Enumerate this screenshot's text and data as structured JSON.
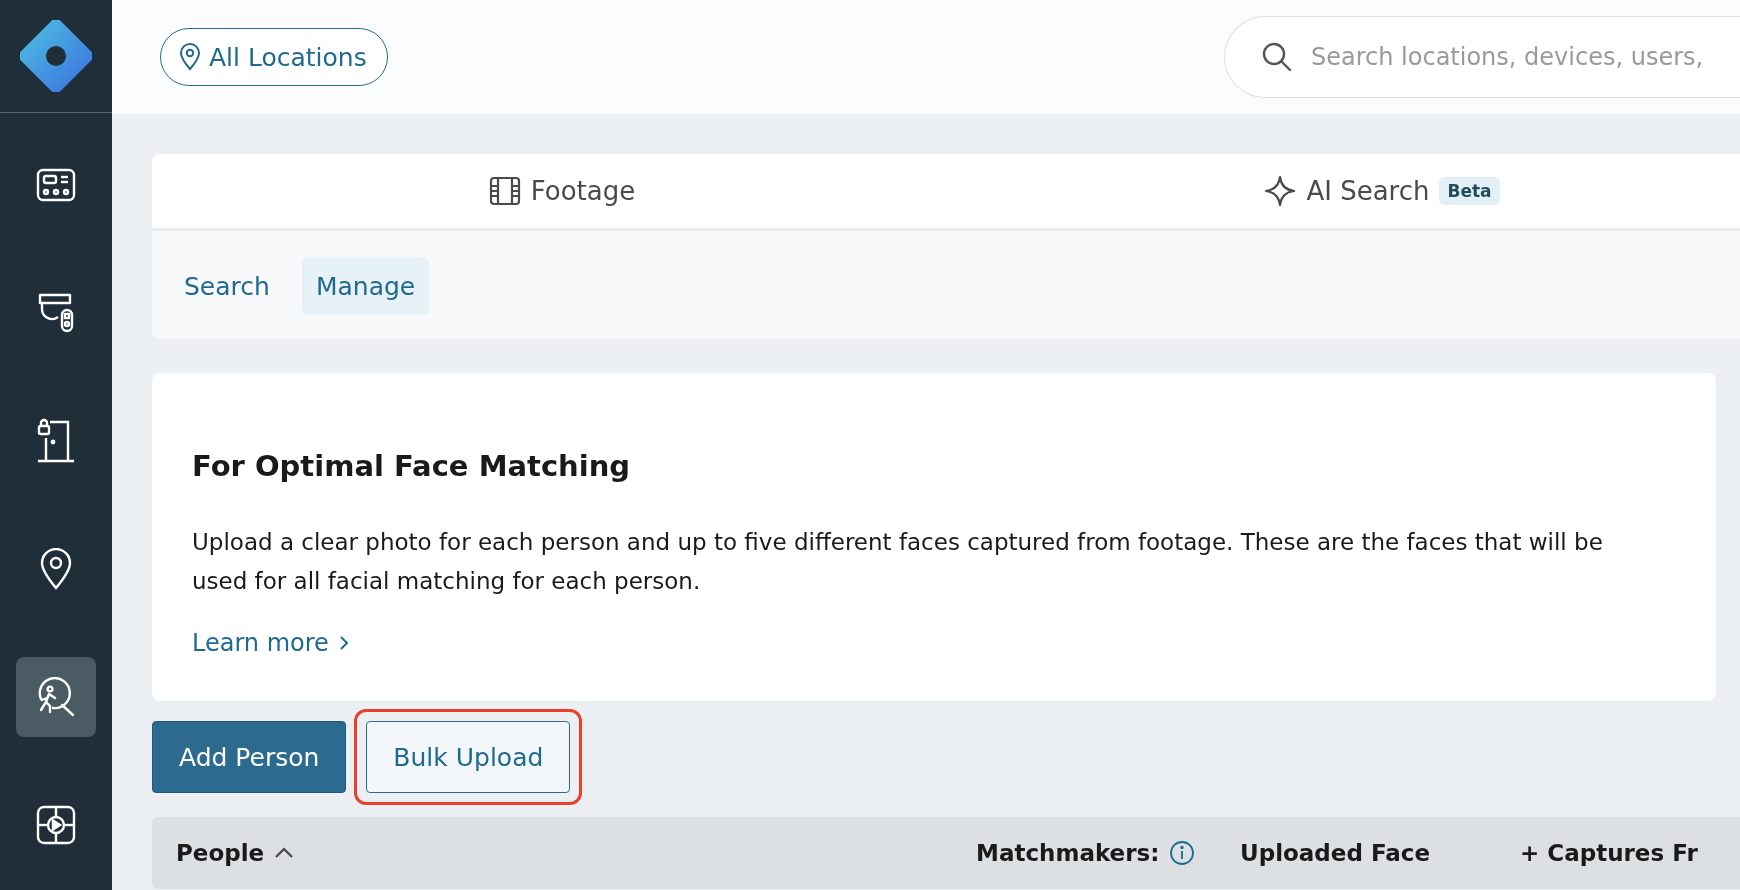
{
  "sidebar": {
    "items": [
      {
        "kind": "panel",
        "selected": false
      },
      {
        "kind": "camera",
        "selected": false
      },
      {
        "kind": "door",
        "selected": false
      },
      {
        "kind": "pin",
        "selected": false
      },
      {
        "kind": "search",
        "selected": true
      },
      {
        "kind": "player",
        "selected": false
      }
    ]
  },
  "top_bar": {
    "location_button": "All Locations",
    "search": {
      "placeholder": "Search locations, devices, users,"
    }
  },
  "tabs": [
    {
      "kind": "film",
      "label": "Footage",
      "selected": false
    },
    {
      "kind": "sparkle",
      "label": "AI Search",
      "badge": "Beta",
      "selected": false
    }
  ],
  "sub_tabs": [
    {
      "label": "Search",
      "selected": false
    },
    {
      "label": "Manage",
      "selected": true
    }
  ],
  "info_card": {
    "title": "For Optimal Face Matching",
    "text": "Upload a clear photo for each person and up to five different faces captured from footage. These are the faces that will be used for all facial matching for each person.",
    "link": "Learn more"
  },
  "buttons": [
    {
      "label": "Add Person",
      "kind": "primary",
      "highlighted": false
    },
    {
      "label": "Bulk Upload",
      "kind": "secondary",
      "highlighted": true
    }
  ],
  "table": {
    "columns": [
      {
        "label": "People",
        "sorted": true,
        "info": false
      },
      {
        "label": "Matchmakers:",
        "sorted": false,
        "info": true
      },
      {
        "label": "Uploaded Face",
        "sorted": false,
        "info": false
      },
      {
        "label": "+ Captures Fr",
        "sorted": false,
        "info": false
      }
    ]
  }
}
